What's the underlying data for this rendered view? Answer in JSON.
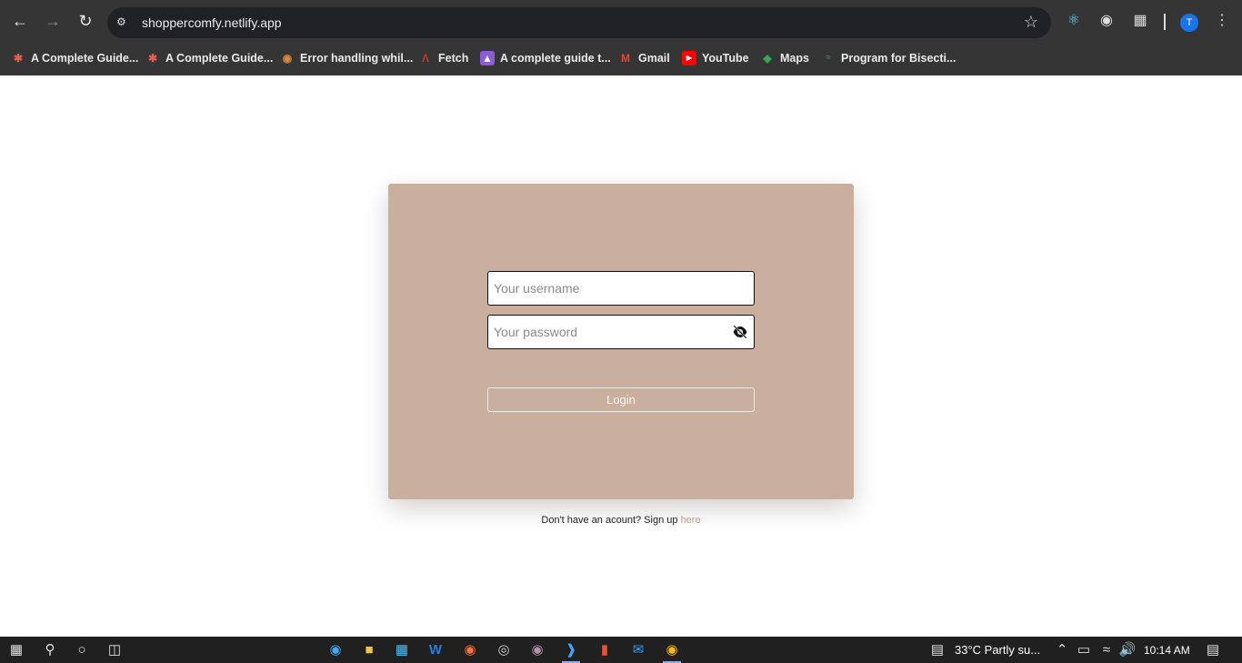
{
  "browser": {
    "url": "shoppercomfy.netlify.app",
    "avatar_letter": "T",
    "bookmarks": [
      {
        "label": "A Complete Guide...",
        "icon": "asterisk-icon",
        "color": "#e85c4a"
      },
      {
        "label": "A Complete Guide...",
        "icon": "asterisk-icon",
        "color": "#e85c4a"
      },
      {
        "label": "Error handling whil...",
        "icon": "owl-icon",
        "color": "#d98b3a"
      },
      {
        "label": "Fetch",
        "icon": "tower-icon",
        "color": "#c0392b"
      },
      {
        "label": "A complete guide t...",
        "icon": "rocket-icon",
        "color": "#8e5bd8"
      },
      {
        "label": "Gmail",
        "icon": "gmail-icon",
        "color": "#ea4335"
      },
      {
        "label": "YouTube",
        "icon": "youtube-icon",
        "color": "#ff0000"
      },
      {
        "label": "Maps",
        "icon": "maps-icon",
        "color": "#34a853"
      },
      {
        "label": "Program for Bisecti...",
        "icon": "gfg-icon",
        "color": "#2f8d46"
      }
    ]
  },
  "login": {
    "username_placeholder": "Your username",
    "password_placeholder": "Your password",
    "login_label": "Login",
    "signup_text": "Don't have an acount? Sign up ",
    "signup_link": "here"
  },
  "taskbar": {
    "weather": "33°C  Partly su...",
    "time": "10:14 AM"
  },
  "colors": {
    "card": "#caaf9f",
    "link": "#c49f88",
    "chrome": "#353535"
  }
}
